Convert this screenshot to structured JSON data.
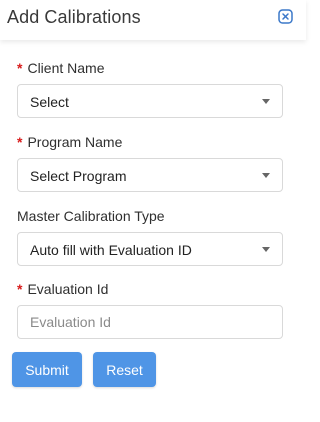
{
  "dialog": {
    "title": "Add Calibrations",
    "close_icon": "close-x-icon"
  },
  "form": {
    "required_marker": "*",
    "client_name": {
      "label": "Client Name",
      "required": true,
      "value": "Select"
    },
    "program_name": {
      "label": "Program Name",
      "required": true,
      "value": "Select Program"
    },
    "master_calibration_type": {
      "label": "Master Calibration Type",
      "required": false,
      "value": "Auto fill with Evaluation ID"
    },
    "evaluation_id": {
      "label": "Evaluation Id",
      "required": true,
      "value": "",
      "placeholder": "Evaluation Id"
    }
  },
  "actions": {
    "submit_label": "Submit",
    "reset_label": "Reset"
  },
  "colors": {
    "accent": "#4f95e6",
    "required": "#d81b1b",
    "close_icon": "#3b78c9"
  }
}
